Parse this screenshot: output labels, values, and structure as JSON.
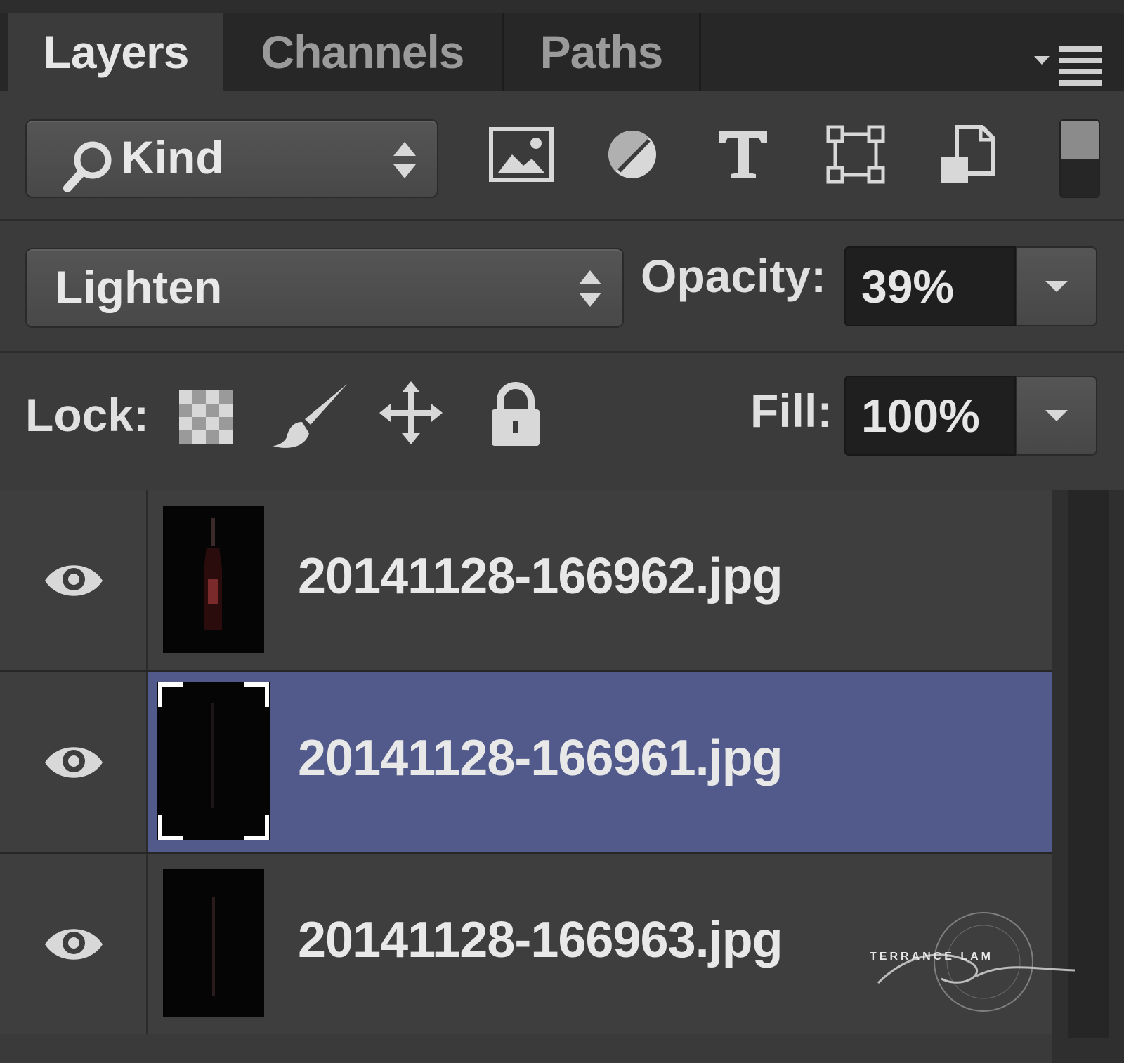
{
  "tabs": [
    {
      "label": "Layers",
      "active": true
    },
    {
      "label": "Channels",
      "active": false
    },
    {
      "label": "Paths",
      "active": false
    }
  ],
  "filter": {
    "kind_label": "Kind",
    "icons": [
      "image-filter-icon",
      "adjustment-filter-icon",
      "type-filter-icon",
      "shape-filter-icon",
      "smart-object-filter-icon"
    ]
  },
  "blend": {
    "mode": "Lighten",
    "opacity_label": "Opacity:",
    "opacity_value": "39%"
  },
  "lock": {
    "label": "Lock:",
    "fill_label": "Fill:",
    "fill_value": "100%"
  },
  "layers": [
    {
      "name": "20141128-166962.jpg",
      "visible": true,
      "selected": false
    },
    {
      "name": "20141128-166961.jpg",
      "visible": true,
      "selected": true
    },
    {
      "name": "20141128-166963.jpg",
      "visible": true,
      "selected": false
    }
  ],
  "watermark": {
    "text": "TERRANCE LAM"
  },
  "colors": {
    "panel_bg": "#3b3b3b",
    "selected_layer": "#515a8a",
    "text": "#e6e6e6"
  }
}
